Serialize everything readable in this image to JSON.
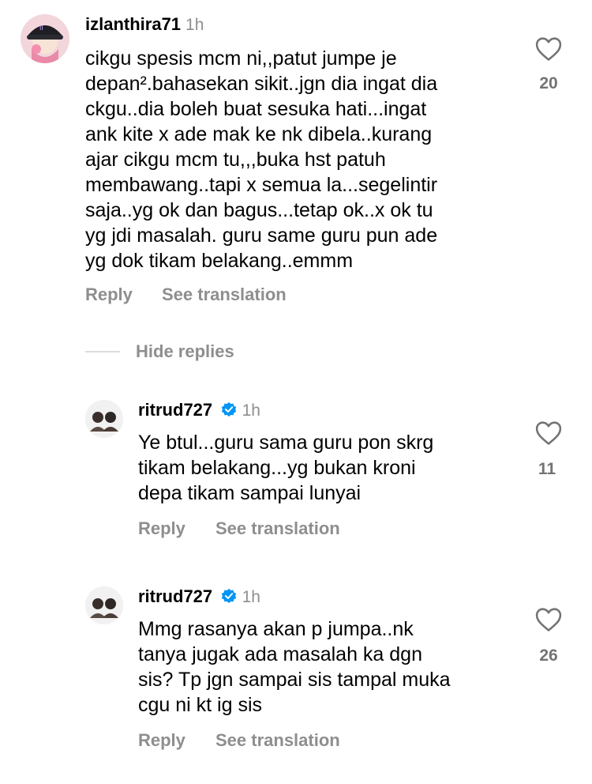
{
  "comments": [
    {
      "username": "izlanthira71",
      "time": "1h",
      "text": "cikgu spesis mcm ni,,patut jumpe je\ndepan².bahasekan sikit..jgn dia ingat dia\nckgu..dia boleh buat sesuka hati...ingat\nank kite x ade mak ke nk dibela..kurang\najar cikgu mcm tu,,,buka hst patuh\nmembawang..tapi x semua la...segelintir\nsaja..yg ok dan bagus...tetap ok..x ok tu\nyg jdi masalah. guru same guru pun ade\nyg dok tikam belakang..emmm",
      "likes": "20",
      "reply": "Reply",
      "translate": "See translation"
    }
  ],
  "hide_replies": "Hide replies",
  "replies": [
    {
      "username": "ritrud727",
      "time": "1h",
      "text": "Ye btul...guru sama guru pon skrg\ntikam belakang...yg bukan kroni\ndepa tikam sampai lunyai",
      "likes": "11",
      "reply": "Reply",
      "translate": "See translation"
    },
    {
      "username": "ritrud727",
      "time": "1h",
      "text": "Mmg rasanya akan p jumpa..nk\ntanya jugak ada masalah ka dgn\nsis? Tp jgn sampai sis tampal muka\ncgu ni kt ig sis",
      "likes": "26",
      "reply": "Reply",
      "translate": "See translation"
    }
  ],
  "colors": {
    "verified": "#0095f6",
    "muted": "#8e8e8e"
  }
}
